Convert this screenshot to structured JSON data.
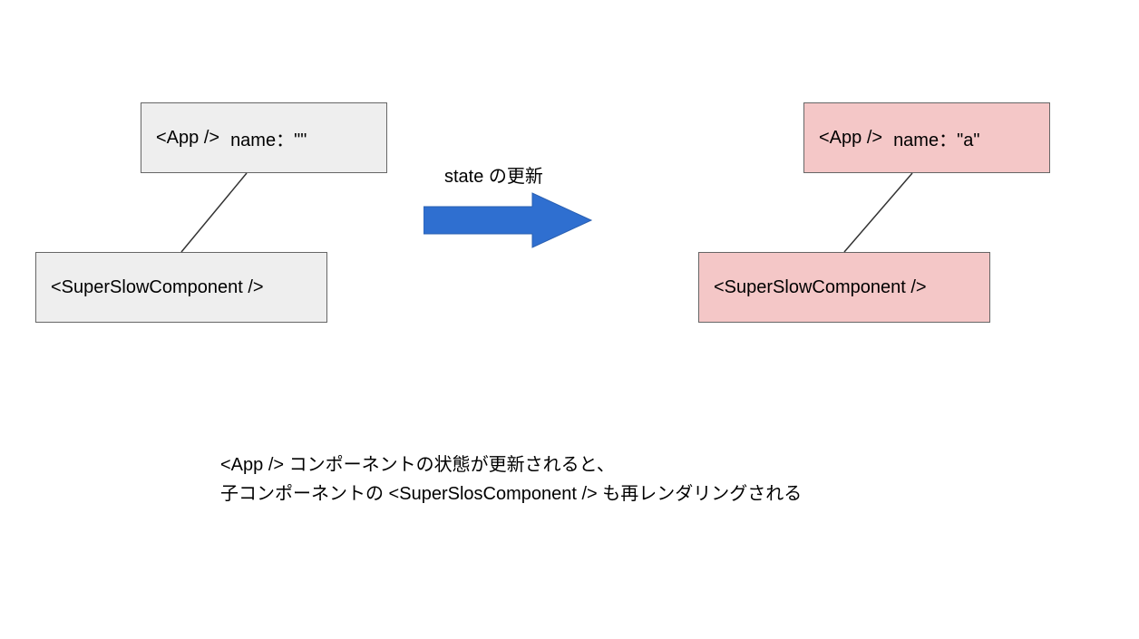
{
  "diagram": {
    "left_app": {
      "component": "<App />",
      "state": "name：\"\""
    },
    "left_child": {
      "component": "<SuperSlowComponent />"
    },
    "right_app": {
      "component": "<App />",
      "state": "name：\"a\""
    },
    "right_child": {
      "component": "<SuperSlowComponent />"
    },
    "arrow_label": "state の更新",
    "description_line1": "<App /> コンポーネントの状態が更新されると、",
    "description_line2": "子コンポーネントの <SuperSlosComponent /> も再レンダリングされる"
  }
}
